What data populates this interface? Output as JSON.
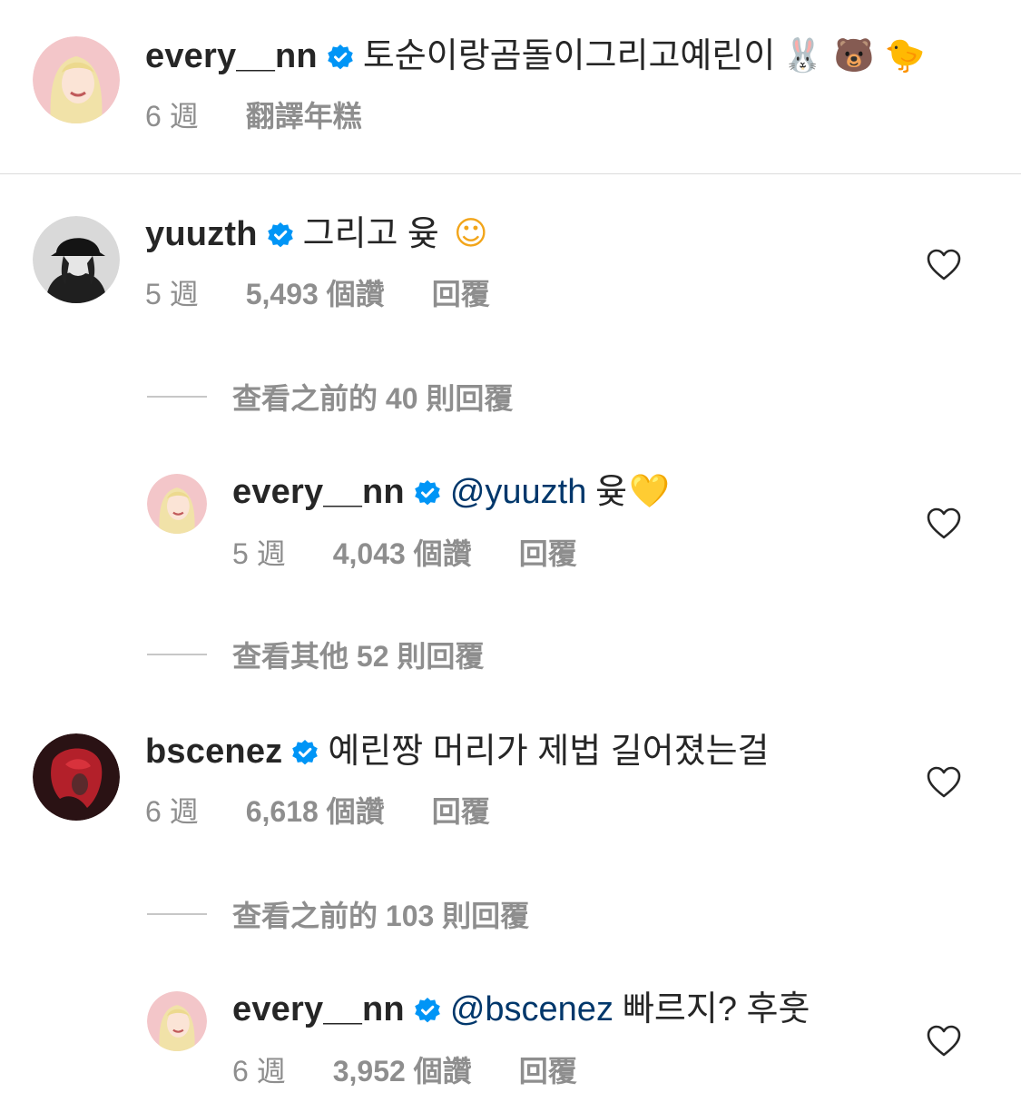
{
  "caption": {
    "username": "every__nn",
    "text": "토순이랑곰돌이그리고예린이",
    "emojis": "🐰 🐻 🐤",
    "time": "6 週",
    "translate_label": "翻譯年糕"
  },
  "comments": [
    {
      "username": "yuuzth",
      "text": "그리고 윶",
      "emoji": "☺",
      "time": "5 週",
      "likes": "5,493 個讚",
      "reply_label": "回覆"
    },
    {
      "username": "every__nn",
      "mention": "@yuuzth",
      "text": "윶",
      "emoji": "💛",
      "time": "5 週",
      "likes": "4,043 個讚",
      "reply_label": "回覆"
    },
    {
      "username": "bscenez",
      "text": "예린짱 머리가 제법 길어졌는걸",
      "time": "6 週",
      "likes": "6,618 個讚",
      "reply_label": "回覆"
    },
    {
      "username": "every__nn",
      "mention": "@bscenez",
      "text": "빠르지? 후훗",
      "time": "6 週",
      "likes": "3,952 個讚",
      "reply_label": "回覆"
    }
  ],
  "view_replies": [
    "查看之前的 40 則回覆",
    "查看其他 52 則回覆",
    "查看之前的 103 則回覆"
  ],
  "icons": {
    "verified": "verified-badge-icon",
    "like": "heart-outline-icon"
  },
  "colors": {
    "verified_blue": "#0095f6",
    "secondary_text": "#8e8e8e",
    "mention_link": "#00376b"
  }
}
